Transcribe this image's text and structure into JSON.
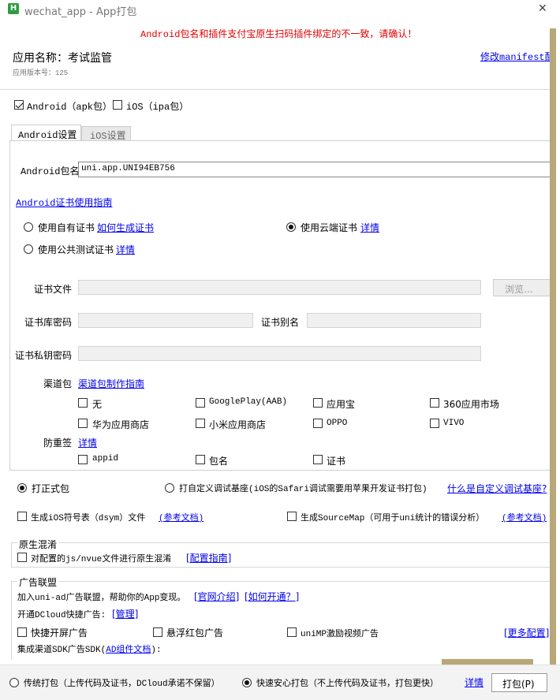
{
  "window": {
    "title": "wechat_app - App打包",
    "close": "✕"
  },
  "warning": "Android包名和插件支付宝原生扫码插件绑定的不一致，请确认！",
  "app": {
    "name_label": "应用名称：考试监管",
    "version_label": "应用版本号：125",
    "edit_manifest": "修改manifest配置"
  },
  "platforms": {
    "android": "Android（apk包）",
    "ios": "iOS（ipa包）"
  },
  "tabs": [
    "Android设置",
    "iOS设置"
  ],
  "package": {
    "label": "Android包名",
    "value": "uni.app.UNI94EB756"
  },
  "cert_guide": "Android证书使用指南",
  "cert": {
    "own": "使用自有证书",
    "own_link": "如何生成证书",
    "cloud": "使用云端证书",
    "cloud_link": "详情",
    "public": "使用公共测试证书",
    "public_link": "详情"
  },
  "fields": {
    "file": "证书文件",
    "browse": "浏览...",
    "store_pwd": "证书库密码",
    "alias": "证书别名",
    "key_pwd": "证书私钥密码"
  },
  "channel": {
    "label": "渠道包",
    "guide": "渠道包制作指南",
    "items": [
      "无",
      "GooglePlay(AAB)",
      "应用宝",
      "360应用市场",
      "华为应用商店",
      "小米应用商店",
      "OPPO",
      "VIVO"
    ]
  },
  "anti": {
    "label": "防重签",
    "link": "详情",
    "items": [
      "appid",
      "包名",
      "证书"
    ]
  },
  "build": {
    "formal": "打正式包",
    "custom": "打自定义调试基座(iOS的Safari调试需要用苹果开发证书打包)",
    "custom_link": "什么是自定义调试基座?"
  },
  "symbols": {
    "dsym": "生成iOS符号表（dsym）文件",
    "dsym_link": "(参考文档)",
    "sourcemap": "生成SourceMap（可用于uni统计的错误分析）",
    "sourcemap_link": "(参考文档)"
  },
  "obf": {
    "title": "原生混淆",
    "check": "对配置的js/nvue文件进行原生混淆",
    "link": "[配置指南]"
  },
  "ads": {
    "title": "广告联盟",
    "desc": "加入uni-ad广告联盟，帮助你的App变现。",
    "link1": "[官网介绍]",
    "link2": "[如何开通？]",
    "dc_label": "开通DCloud快捷广告:",
    "manage": "[管理]",
    "splash": "快捷开屏广告",
    "float": "悬浮红包广告",
    "video": "uniMP激励视频广告",
    "more": "[更多配置]",
    "sdk_label": "集成渠道SDK广告SDK(",
    "sdk_link": "AD组件文档",
    "sdk_end": "):"
  },
  "footer": {
    "traditional": "传统打包（上传代码及证书，DCloud承诺不保留）",
    "fast": "快速安心打包（不上传代码及证书，打包更快）",
    "detail": "详情",
    "pack": "打包(P)"
  },
  "colors": {
    "warning": "#e00000",
    "link": "#0000ee",
    "scroll": "#b8a878"
  }
}
